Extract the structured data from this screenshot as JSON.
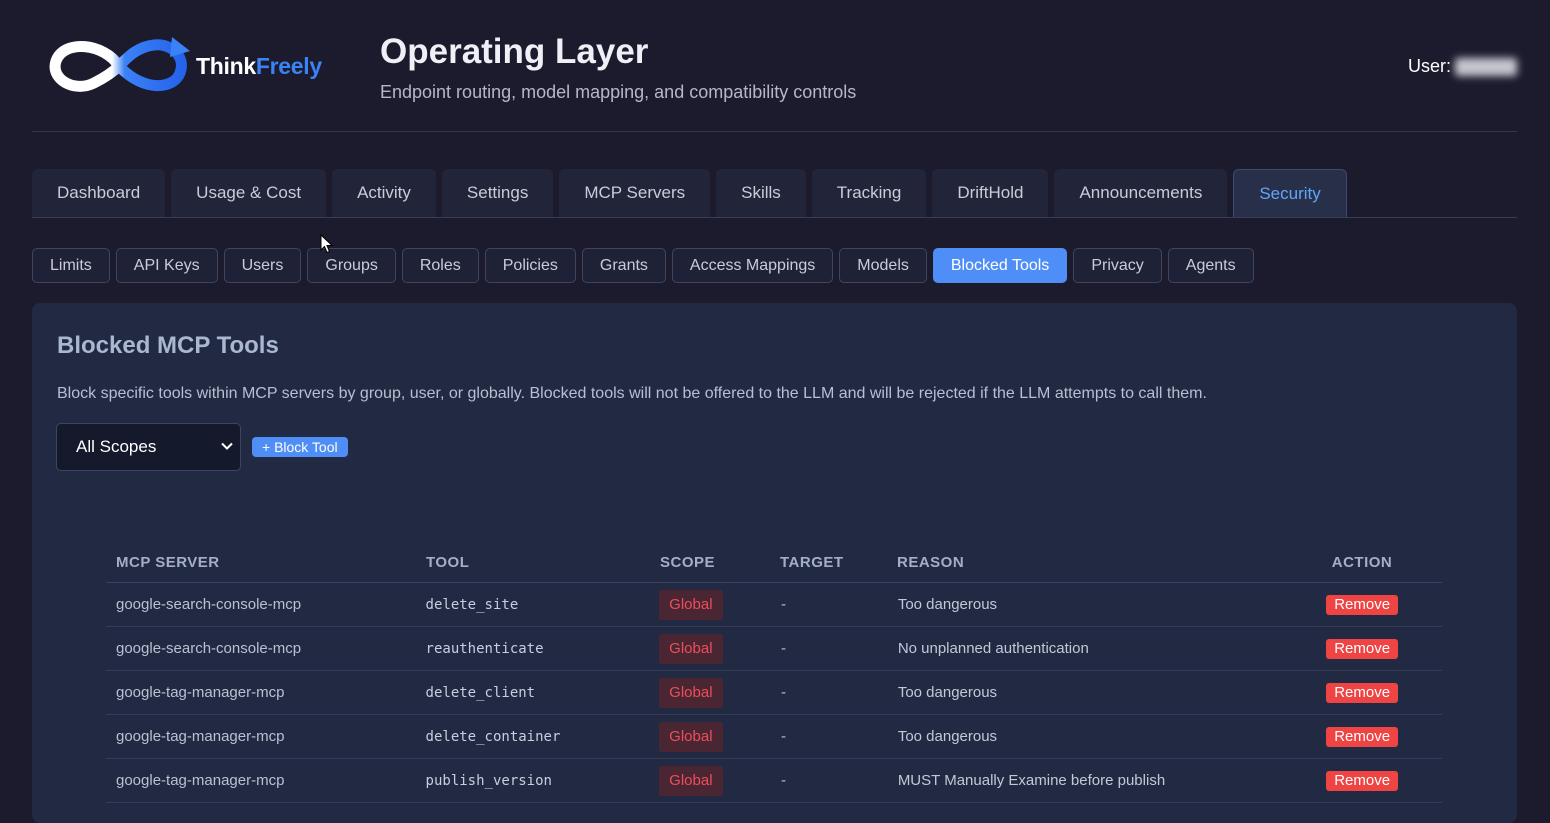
{
  "header": {
    "logo_text_1": "Think",
    "logo_text_2": "Freely",
    "title": "Operating Layer",
    "subtitle": "Endpoint routing, model mapping, and compatibility controls",
    "user_label": "User:"
  },
  "tabs": [
    {
      "label": "Dashboard"
    },
    {
      "label": "Usage & Cost"
    },
    {
      "label": "Activity"
    },
    {
      "label": "Settings"
    },
    {
      "label": "MCP Servers"
    },
    {
      "label": "Skills"
    },
    {
      "label": "Tracking"
    },
    {
      "label": "DriftHold"
    },
    {
      "label": "Announcements"
    },
    {
      "label": "Security",
      "active": true
    }
  ],
  "subtabs": [
    {
      "label": "Limits"
    },
    {
      "label": "API Keys"
    },
    {
      "label": "Users"
    },
    {
      "label": "Groups"
    },
    {
      "label": "Roles"
    },
    {
      "label": "Policies"
    },
    {
      "label": "Grants"
    },
    {
      "label": "Access Mappings"
    },
    {
      "label": "Models"
    },
    {
      "label": "Blocked Tools",
      "active": true
    },
    {
      "label": "Privacy"
    },
    {
      "label": "Agents"
    }
  ],
  "panel": {
    "title": "Blocked MCP Tools",
    "description": "Block specific tools within MCP servers by group, user, or globally. Blocked tools will not be offered to the LLM and will be rejected if the LLM attempts to call them.",
    "scope_select": "All Scopes",
    "block_button": "+ Block Tool"
  },
  "table": {
    "columns": [
      "MCP SERVER",
      "TOOL",
      "SCOPE",
      "TARGET",
      "REASON",
      "ACTION"
    ],
    "rows": [
      {
        "server": "google-search-console-mcp",
        "tool": "delete_site",
        "scope": "Global",
        "target": "-",
        "reason": "Too dangerous",
        "action": "Remove"
      },
      {
        "server": "google-search-console-mcp",
        "tool": "reauthenticate",
        "scope": "Global",
        "target": "-",
        "reason": "No unplanned authentication",
        "action": "Remove"
      },
      {
        "server": "google-tag-manager-mcp",
        "tool": "delete_client",
        "scope": "Global",
        "target": "-",
        "reason": "Too dangerous",
        "action": "Remove"
      },
      {
        "server": "google-tag-manager-mcp",
        "tool": "delete_container",
        "scope": "Global",
        "target": "-",
        "reason": "Too dangerous",
        "action": "Remove"
      },
      {
        "server": "google-tag-manager-mcp",
        "tool": "publish_version",
        "scope": "Global",
        "target": "-",
        "reason": "MUST Manually Examine before publish",
        "action": "Remove"
      }
    ]
  },
  "colors": {
    "background": "#1c1b2e",
    "accent": "#4f8ef7",
    "danger": "#ef4444"
  },
  "icons": [
    "infinity-logo-icon",
    "chevron-down-icon",
    "mouse-cursor-icon"
  ]
}
